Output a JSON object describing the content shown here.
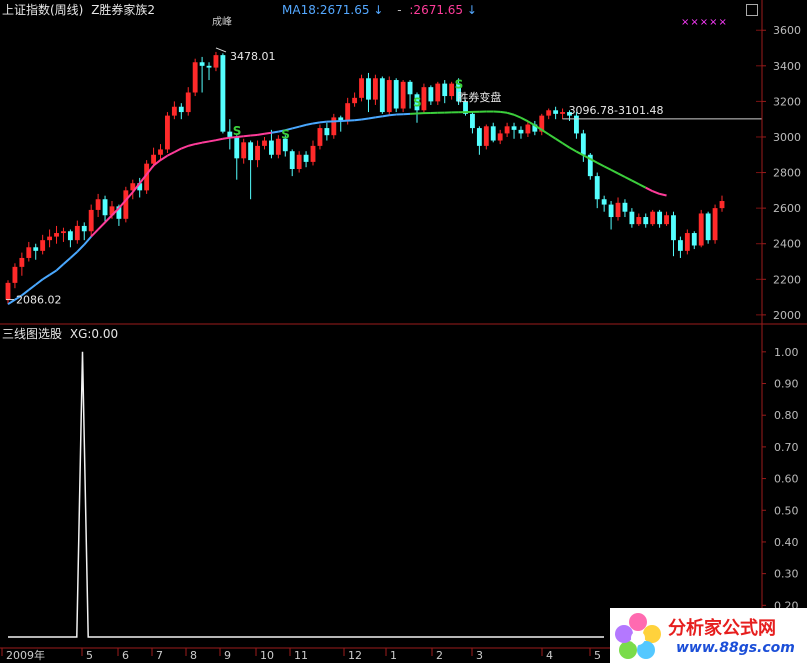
{
  "header": {
    "title": "上证指数(周线)",
    "indicator": "Z胜券家族2",
    "ma_text": "MA18:2671.65",
    "ma_arrow": "↓",
    "dash": "-",
    "value2": ":2671.65",
    "value2_arrow": "↓",
    "stars": "×××××",
    "top_label": "成峰"
  },
  "sub_header": {
    "title": "三线图选股",
    "xg": "XG:0.00"
  },
  "watermark": {
    "text": "分析家公式网",
    "url": "www.88gs.com"
  },
  "colors": {
    "up": "#ff2a2a",
    "down": "#54ffff",
    "ma_pink": "#ff3c9a",
    "ma_blue": "#4aa8ff",
    "ma_green": "#3ccf3c",
    "signal": "#3ccf3c",
    "axis": "#9b1b1b",
    "grid": "#7a1212"
  },
  "chart_data": [
    {
      "type": "candlestick",
      "title": "上证指数(周线)",
      "ylim": [
        1960,
        3680
      ],
      "yticks": [
        2000,
        2200,
        2400,
        2600,
        2800,
        3000,
        3200,
        3400,
        3600
      ],
      "x_labels": [
        "2009年",
        "5",
        "6",
        "7",
        "8",
        "9",
        "10",
        "11",
        "12",
        "1",
        "2",
        "3",
        "4",
        "5"
      ],
      "annotations": [
        {
          "text": "3478.01",
          "index": 30,
          "value": 3478.01
        },
        {
          "text": "2086.02",
          "index": 0,
          "value": 2086.02
        },
        {
          "text": "3096.78-3101.48",
          "index": 80,
          "value": 3101.48
        },
        {
          "text": "胜券变盘",
          "index": 68,
          "value": 3140
        }
      ],
      "hline": 3101.48,
      "signals": [
        {
          "text": "S",
          "index": 33,
          "value": 3040
        },
        {
          "text": "S",
          "index": 40,
          "value": 3020
        },
        {
          "text": "S",
          "index": 59,
          "value": 3200
        },
        {
          "text": "S",
          "index": 65,
          "value": 3300
        }
      ],
      "series": [
        {
          "type": "candles",
          "values": [
            [
              2085,
              2180,
              2060,
              2195
            ],
            [
              2180,
              2270,
              2150,
              2290
            ],
            [
              2270,
              2320,
              2220,
              2350
            ],
            [
              2320,
              2380,
              2300,
              2410
            ],
            [
              2380,
              2360,
              2310,
              2400
            ],
            [
              2360,
              2420,
              2340,
              2450
            ],
            [
              2420,
              2440,
              2380,
              2480
            ],
            [
              2440,
              2460,
              2400,
              2500
            ],
            [
              2460,
              2470,
              2410,
              2490
            ],
            [
              2470,
              2420,
              2380,
              2480
            ],
            [
              2420,
              2500,
              2400,
              2530
            ],
            [
              2500,
              2470,
              2420,
              2520
            ],
            [
              2470,
              2590,
              2440,
              2620
            ],
            [
              2590,
              2650,
              2550,
              2680
            ],
            [
              2650,
              2560,
              2520,
              2670
            ],
            [
              2560,
              2610,
              2540,
              2640
            ],
            [
              2610,
              2540,
              2500,
              2620
            ],
            [
              2540,
              2700,
              2520,
              2720
            ],
            [
              2700,
              2740,
              2650,
              2760
            ],
            [
              2740,
              2700,
              2660,
              2770
            ],
            [
              2700,
              2850,
              2680,
              2870
            ],
            [
              2850,
              2900,
              2830,
              2940
            ],
            [
              2900,
              2930,
              2870,
              2960
            ],
            [
              2930,
              3120,
              2910,
              3140
            ],
            [
              3120,
              3170,
              3100,
              3200
            ],
            [
              3170,
              3140,
              3100,
              3190
            ],
            [
              3140,
              3250,
              3120,
              3280
            ],
            [
              3250,
              3420,
              3230,
              3440
            ],
            [
              3420,
              3400,
              3250,
              3450
            ],
            [
              3400,
              3390,
              3320,
              3420
            ],
            [
              3390,
              3460,
              3370,
              3478
            ],
            [
              3460,
              3030,
              3020,
              3470
            ],
            [
              3030,
              3000,
              2930,
              3100
            ],
            [
              3000,
              2880,
              2760,
              3010
            ],
            [
              2880,
              2970,
              2850,
              2990
            ],
            [
              2970,
              2870,
              2650,
              2980
            ],
            [
              2870,
              2950,
              2830,
              2980
            ],
            [
              2950,
              2980,
              2930,
              3000
            ],
            [
              2980,
              2900,
              2880,
              3040
            ],
            [
              2900,
              2990,
              2880,
              3010
            ],
            [
              2990,
              2920,
              2890,
              3010
            ],
            [
              2920,
              2820,
              2780,
              2930
            ],
            [
              2820,
              2900,
              2800,
              2920
            ],
            [
              2900,
              2860,
              2830,
              2920
            ],
            [
              2860,
              2950,
              2840,
              2980
            ],
            [
              2950,
              3050,
              2930,
              3070
            ],
            [
              3050,
              3010,
              2980,
              3080
            ],
            [
              3010,
              3110,
              2990,
              3130
            ],
            [
              3110,
              3090,
              3030,
              3120
            ],
            [
              3090,
              3190,
              3070,
              3220
            ],
            [
              3190,
              3220,
              3170,
              3250
            ],
            [
              3220,
              3330,
              3200,
              3350
            ],
            [
              3330,
              3210,
              3140,
              3360
            ],
            [
              3210,
              3330,
              3180,
              3350
            ],
            [
              3330,
              3140,
              3130,
              3340
            ],
            [
              3140,
              3320,
              3120,
              3340
            ],
            [
              3320,
              3160,
              3140,
              3330
            ],
            [
              3160,
              3310,
              3140,
              3320
            ],
            [
              3310,
              3240,
              3160,
              3320
            ],
            [
              3240,
              3150,
              3080,
              3250
            ],
            [
              3150,
              3280,
              3130,
              3300
            ],
            [
              3280,
              3200,
              3180,
              3290
            ],
            [
              3200,
              3300,
              3180,
              3310
            ],
            [
              3300,
              3230,
              3190,
              3320
            ],
            [
              3230,
              3300,
              3210,
              3310
            ],
            [
              3300,
              3200,
              3180,
              3330
            ],
            [
              3200,
              3130,
              3120,
              3210
            ],
            [
              3130,
              3050,
              3020,
              3140
            ],
            [
              3050,
              2950,
              2900,
              3060
            ],
            [
              2950,
              3060,
              2930,
              3070
            ],
            [
              3060,
              2980,
              2970,
              3080
            ],
            [
              2980,
              3020,
              2960,
              3040
            ],
            [
              3020,
              3060,
              3000,
              3080
            ],
            [
              3060,
              3040,
              2990,
              3080
            ],
            [
              3040,
              3020,
              2990,
              3060
            ],
            [
              3020,
              3070,
              3000,
              3090
            ],
            [
              3070,
              3030,
              3010,
              3090
            ],
            [
              3030,
              3120,
              3010,
              3130
            ],
            [
              3120,
              3150,
              3100,
              3160
            ],
            [
              3150,
              3130,
              3100,
              3170
            ],
            [
              3130,
              3140,
              3100,
              3160
            ],
            [
              3140,
              3120,
              3090,
              3150
            ],
            [
              3120,
              3020,
              2990,
              3140
            ],
            [
              3020,
              2900,
              2860,
              3040
            ],
            [
              2900,
              2780,
              2760,
              2910
            ],
            [
              2780,
              2650,
              2600,
              2800
            ],
            [
              2650,
              2620,
              2580,
              2670
            ],
            [
              2620,
              2550,
              2480,
              2640
            ],
            [
              2550,
              2630,
              2530,
              2660
            ],
            [
              2630,
              2580,
              2550,
              2650
            ],
            [
              2580,
              2510,
              2490,
              2600
            ],
            [
              2510,
              2550,
              2500,
              2570
            ],
            [
              2550,
              2510,
              2490,
              2570
            ],
            [
              2510,
              2580,
              2500,
              2590
            ],
            [
              2580,
              2510,
              2490,
              2590
            ],
            [
              2510,
              2560,
              2500,
              2580
            ],
            [
              2560,
              2420,
              2330,
              2580
            ],
            [
              2420,
              2360,
              2320,
              2440
            ],
            [
              2360,
              2460,
              2340,
              2480
            ],
            [
              2460,
              2390,
              2370,
              2470
            ],
            [
              2390,
              2570,
              2380,
              2590
            ],
            [
              2570,
              2420,
              2400,
              2580
            ],
            [
              2420,
              2600,
              2400,
              2620
            ],
            [
              2600,
              2640,
              2580,
              2670
            ]
          ]
        },
        {
          "type": "ma",
          "values": [
            2060,
            2085,
            2110,
            2140,
            2170,
            2200,
            2225,
            2250,
            2285,
            2320,
            2355,
            2395,
            2440,
            2480,
            2520,
            2560,
            2600,
            2645,
            2690,
            2740,
            2790,
            2840,
            2870,
            2895,
            2915,
            2935,
            2950,
            2960,
            2968,
            2975,
            2982,
            2990,
            2996,
            3000,
            3004,
            3008,
            3012,
            3018,
            3024,
            3030,
            3038,
            3048,
            3058,
            3068,
            3076,
            3082,
            3086,
            3088,
            3090,
            3092,
            3094,
            3098,
            3104,
            3110,
            3116,
            3122,
            3126,
            3128,
            3130,
            3132,
            3134,
            3135,
            3136,
            3137,
            3138,
            3139,
            3140,
            3141,
            3142,
            3143,
            3143,
            3141,
            3136,
            3125,
            3108,
            3088,
            3065,
            3040,
            3015,
            2990,
            2965,
            2940,
            2918,
            2897,
            2876,
            2855,
            2835,
            2815,
            2795,
            2775,
            2755,
            2735,
            2715,
            2695,
            2680,
            2671
          ]
        }
      ]
    },
    {
      "type": "line",
      "title": "三线图选股",
      "ylim": [
        0.1,
        1.05
      ],
      "yticks": [
        0.2,
        0.3,
        0.4,
        0.5,
        0.6,
        0.7,
        0.8,
        0.9,
        1.0
      ],
      "peak_index": 13,
      "values": [
        0,
        0,
        0,
        0,
        0,
        0,
        0,
        0,
        0,
        0,
        0,
        0,
        0,
        1,
        0,
        0,
        0,
        0,
        0,
        0,
        0,
        0,
        0,
        0,
        0,
        0,
        0,
        0,
        0,
        0,
        0,
        0,
        0,
        0,
        0,
        0,
        0,
        0,
        0,
        0,
        0,
        0,
        0,
        0,
        0,
        0,
        0,
        0,
        0,
        0,
        0,
        0,
        0,
        0,
        0,
        0,
        0,
        0,
        0,
        0,
        0,
        0,
        0,
        0,
        0,
        0,
        0,
        0,
        0,
        0,
        0,
        0,
        0,
        0,
        0,
        0,
        0,
        0,
        0,
        0,
        0,
        0,
        0,
        0,
        0,
        0,
        0,
        0,
        0,
        0,
        0,
        0,
        0,
        0,
        0,
        0,
        0,
        0,
        0,
        0,
        0,
        0,
        0,
        0,
        0
      ]
    }
  ]
}
